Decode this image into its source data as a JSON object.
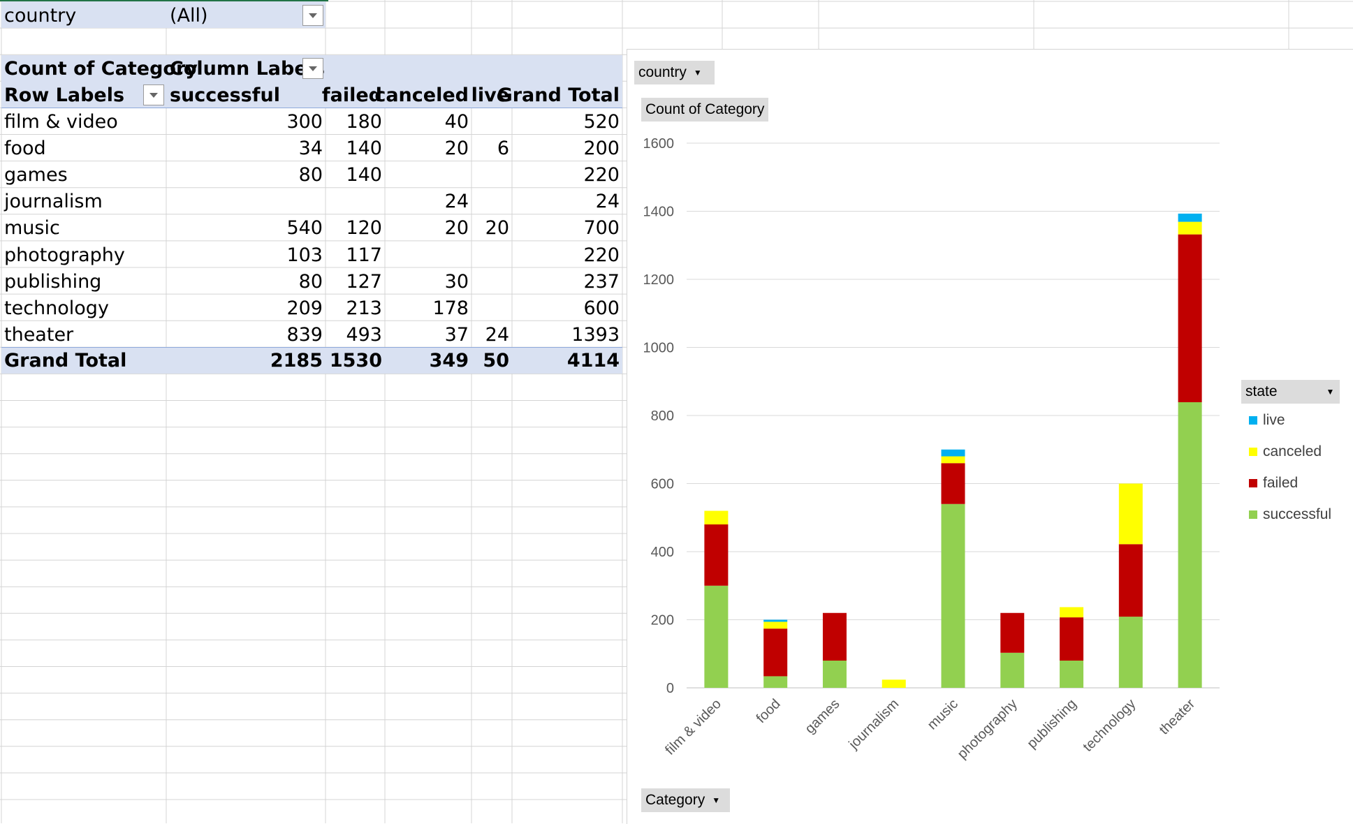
{
  "filter": {
    "field": "country",
    "value": "(All)"
  },
  "pivot": {
    "value_header": "Count of Category",
    "column_labels_header": "Column Labels",
    "row_labels_header": "Row Labels",
    "columns": [
      "successful",
      "failed",
      "canceled",
      "live",
      "Grand Total"
    ],
    "rows": [
      {
        "label": "film & video",
        "values": [
          "300",
          "180",
          "40",
          "",
          "520"
        ]
      },
      {
        "label": "food",
        "values": [
          "34",
          "140",
          "20",
          "6",
          "200"
        ]
      },
      {
        "label": "games",
        "values": [
          "80",
          "140",
          "",
          "",
          "220"
        ]
      },
      {
        "label": "journalism",
        "values": [
          "",
          "",
          "24",
          "",
          "24"
        ]
      },
      {
        "label": "music",
        "values": [
          "540",
          "120",
          "20",
          "20",
          "700"
        ]
      },
      {
        "label": "photography",
        "values": [
          "103",
          "117",
          "",
          "",
          "220"
        ]
      },
      {
        "label": "publishing",
        "values": [
          "80",
          "127",
          "30",
          "",
          "237"
        ]
      },
      {
        "label": "technology",
        "values": [
          "209",
          "213",
          "178",
          "",
          "600"
        ]
      },
      {
        "label": "theater",
        "values": [
          "839",
          "493",
          "37",
          "24",
          "1393"
        ]
      }
    ],
    "grand_total": {
      "label": "Grand Total",
      "values": [
        "2185",
        "1530",
        "349",
        "50",
        "4114"
      ]
    }
  },
  "chart_buttons": {
    "filter": "country",
    "values": "Count of Category",
    "axis": "Category",
    "legend": "state"
  },
  "colors": {
    "successful": "#92d050",
    "failed": "#c00000",
    "canceled": "#ffff00",
    "live": "#00b0f0",
    "pivot_band": "#d9e1f2"
  },
  "chart_data": {
    "type": "bar",
    "stacked": true,
    "categories": [
      "film & video",
      "food",
      "games",
      "journalism",
      "music",
      "photography",
      "publishing",
      "technology",
      "theater"
    ],
    "series": [
      {
        "name": "successful",
        "color": "#92d050",
        "values": [
          300,
          34,
          80,
          0,
          540,
          103,
          80,
          209,
          839
        ]
      },
      {
        "name": "failed",
        "color": "#c00000",
        "values": [
          180,
          140,
          140,
          0,
          120,
          117,
          127,
          213,
          493
        ]
      },
      {
        "name": "canceled",
        "color": "#ffff00",
        "values": [
          40,
          20,
          0,
          24,
          20,
          0,
          30,
          178,
          37
        ]
      },
      {
        "name": "live",
        "color": "#00b0f0",
        "values": [
          0,
          6,
          0,
          0,
          20,
          0,
          0,
          0,
          24
        ]
      }
    ],
    "legend_order": [
      "live",
      "canceled",
      "failed",
      "successful"
    ],
    "legend_title": "state",
    "legend_position": "right",
    "yticks": [
      "0",
      "200",
      "400",
      "600",
      "800",
      "1000",
      "1200",
      "1400",
      "1600"
    ],
    "ylim": [
      0,
      1600
    ],
    "grid": true
  }
}
